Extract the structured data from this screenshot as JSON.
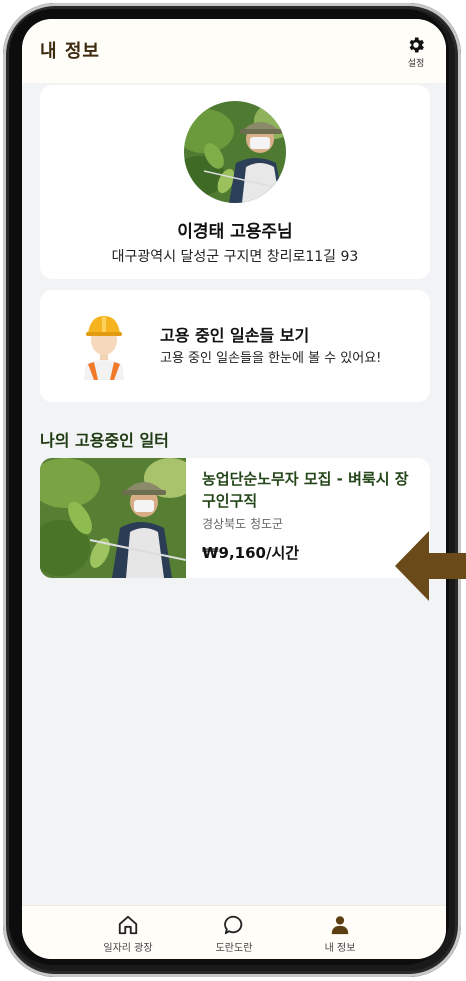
{
  "header": {
    "title": "내 정보",
    "settings_label": "설정",
    "settings_icon": "gear-icon"
  },
  "profile": {
    "name": "이경태 고용주님",
    "address": "대구광역시 달성군 구지면 창리로11길 93"
  },
  "workers_card": {
    "title": "고용 중인 일손들 보기",
    "description": "고용 중인 일손들을 한눈에 볼 수 있어요!"
  },
  "section_title": "나의 고용중인 일터",
  "jobs": [
    {
      "title": "농업단순노무자 모집 - 벼룩시 장구인구직",
      "location": "경상북도 청도군",
      "wage": "₩9,160/시간"
    }
  ],
  "bottom_nav": {
    "items": [
      {
        "label": "일자리 광장",
        "icon": "home-icon"
      },
      {
        "label": "도란도란",
        "icon": "chat-bubble-icon"
      },
      {
        "label": "내 정보",
        "icon": "person-icon"
      }
    ]
  },
  "colors": {
    "brand_brown": "#6b4a1a",
    "title_green": "#24461a",
    "screen_bg": "#f2f3f5"
  }
}
